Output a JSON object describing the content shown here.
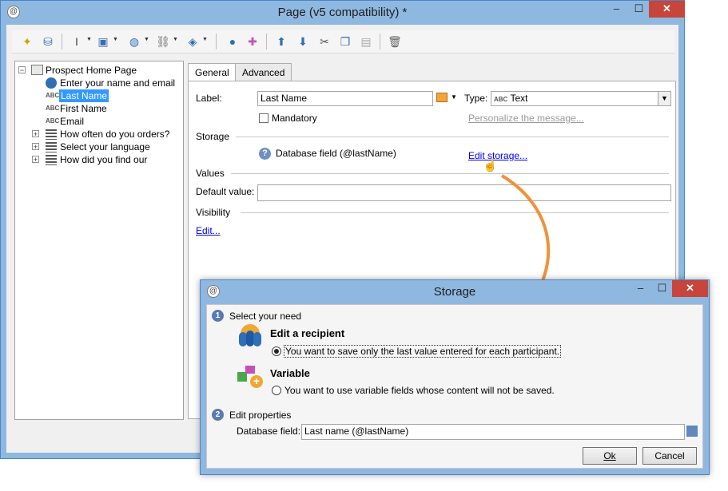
{
  "window": {
    "title": "Page (v5 compatibility) *",
    "minimize": "–",
    "maximize": "☐",
    "close": "✕"
  },
  "toolbar": {
    "icons": [
      "wand-icon",
      "database-icon",
      "text-cursor-icon",
      "select-icon",
      "globe-icon",
      "link-icon",
      "stack-icon",
      "user-icon",
      "add-user-icon",
      "arrow-up-icon",
      "arrow-down-icon",
      "cut-icon",
      "copy-icon",
      "paste-icon",
      "delete-icon"
    ]
  },
  "tree": {
    "root": "Prospect Home Page",
    "items": [
      {
        "label": "Enter your name and email",
        "icon": "globe-icon"
      },
      {
        "label": "Last Name",
        "icon": "abc-icon",
        "selected": true
      },
      {
        "label": "First Name",
        "icon": "abc-icon"
      },
      {
        "label": "Email",
        "icon": "abc-icon"
      },
      {
        "label": "How often do you orders?",
        "icon": "list-icon"
      },
      {
        "label": "Select your language",
        "icon": "list-icon"
      },
      {
        "label": "How did you find our",
        "icon": "list-icon"
      }
    ],
    "abc": "ABC"
  },
  "tabs": [
    {
      "label": "General",
      "active": true
    },
    {
      "label": "Advanced",
      "active": false
    }
  ],
  "general": {
    "label_caption": "Label:",
    "label_value": "Last Name",
    "type_caption": "Type:",
    "type_value": "Text",
    "type_abc": "ABC",
    "mandatory": "Mandatory",
    "personalize": "Personalize the message...",
    "storage_section": "Storage",
    "database_field": "Database field (@lastName)",
    "edit_storage": "Edit storage...",
    "values_section": "Values",
    "default_value_caption": "Default value:",
    "default_value": "",
    "visibility_section": "Visibility",
    "edit": "Edit..."
  },
  "dialog": {
    "title": "Storage",
    "step1": "Select your need",
    "step1_num": "1",
    "recipient_title": "Edit a recipient",
    "recipient_option": "You want to save only the last value entered for each participant.",
    "variable_title": "Variable",
    "variable_option": "You want to use variable fields whose content will not be saved.",
    "step2": "Edit properties",
    "step2_num": "2",
    "db_field_caption": "Database field:",
    "db_field_value": "Last name (@lastName)",
    "ok": "Ok",
    "cancel": "Cancel"
  },
  "colors": {
    "accent": "#4a84c8",
    "close": "#c7453a",
    "arrow": "#f0923a",
    "link": "#0000ee"
  }
}
